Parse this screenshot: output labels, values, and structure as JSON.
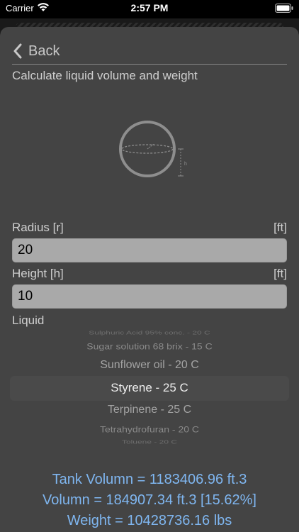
{
  "status": {
    "carrier": "Carrier",
    "time": "2:57 PM"
  },
  "nav": {
    "back_label": "Back"
  },
  "subtitle": "Calculate liquid volume and weight",
  "diagram": {
    "height_mark": "h"
  },
  "fields": [
    {
      "label": "Radius [r]",
      "unit": "[ft]",
      "value": "20"
    },
    {
      "label": "Height [h]",
      "unit": "[ft]",
      "value": "10"
    }
  ],
  "liquid_label": "Liquid",
  "picker": {
    "items": [
      "Sulphuric Acid 95% conc. - 20 C",
      "Sugar solution 68 brix - 15 C",
      "Sunflower oil  - 20 C",
      "Styrene - 25 C",
      "Terpinene - 25 C",
      "Tetrahydrofuran - 20 C",
      "Toluene - 20 C"
    ],
    "selected": "Styrene - 25 C"
  },
  "results": {
    "tank_volume": "Tank Volumn = 1183406.96 ft.3",
    "volume": "Volumn = 184907.34 ft.3 [15.62%]",
    "weight": "Weight = 10428736.16 lbs"
  }
}
